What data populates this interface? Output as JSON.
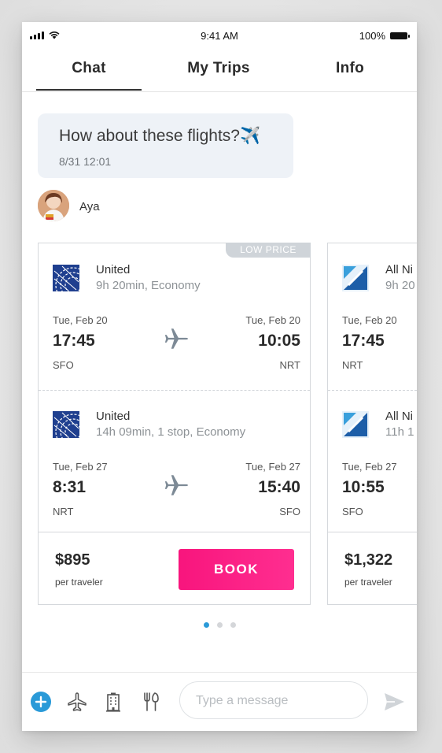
{
  "status_bar": {
    "time": "9:41 AM",
    "battery": "100%"
  },
  "tabs": [
    {
      "label": "Chat",
      "active": true
    },
    {
      "label": "My Trips",
      "active": false
    },
    {
      "label": "Info",
      "active": false
    }
  ],
  "message": {
    "text": "How about these flights?✈️",
    "timestamp": "8/31 12:01",
    "sender": "Aya"
  },
  "cards": [
    {
      "badge": "LOW PRICE",
      "outbound": {
        "airline": "United",
        "details": "9h 20min, Economy",
        "depart_date": "Tue, Feb 20",
        "depart_time": "17:45",
        "depart_code": "SFO",
        "arrive_date": "Tue, Feb 20",
        "arrive_time": "10:05",
        "arrive_code": "NRT"
      },
      "return": {
        "airline": "United",
        "details": "14h 09min, 1 stop, Economy",
        "depart_date": "Tue, Feb 27",
        "depart_time": "8:31",
        "depart_code": "NRT",
        "arrive_date": "Tue, Feb 27",
        "arrive_time": "15:40",
        "arrive_code": "SFO"
      },
      "price": "$895",
      "price_note": "per traveler",
      "book_label": "BOOK"
    },
    {
      "outbound": {
        "airline": "All Ni",
        "details": "9h 20",
        "depart_date": "Tue, Feb 20",
        "depart_time": "17:45",
        "depart_code": "NRT"
      },
      "return": {
        "airline": "All Ni",
        "details": "11h 1",
        "depart_date": "Tue, Feb 27",
        "depart_time": "10:55",
        "depart_code": "SFO"
      },
      "price": "$1,322",
      "price_note": "per traveler"
    }
  ],
  "pager": {
    "count": 3,
    "active": 0
  },
  "composer": {
    "placeholder": "Type a message",
    "icons": [
      "add-icon",
      "airplane-icon",
      "hotel-icon",
      "restaurant-icon",
      "send-icon"
    ]
  },
  "colors": {
    "accent": "#f8157d",
    "tab_underline": "#333333",
    "dot_active": "#2a9ad8",
    "bubble_bg": "#eef2f7",
    "add_button": "#2a9ad8"
  }
}
